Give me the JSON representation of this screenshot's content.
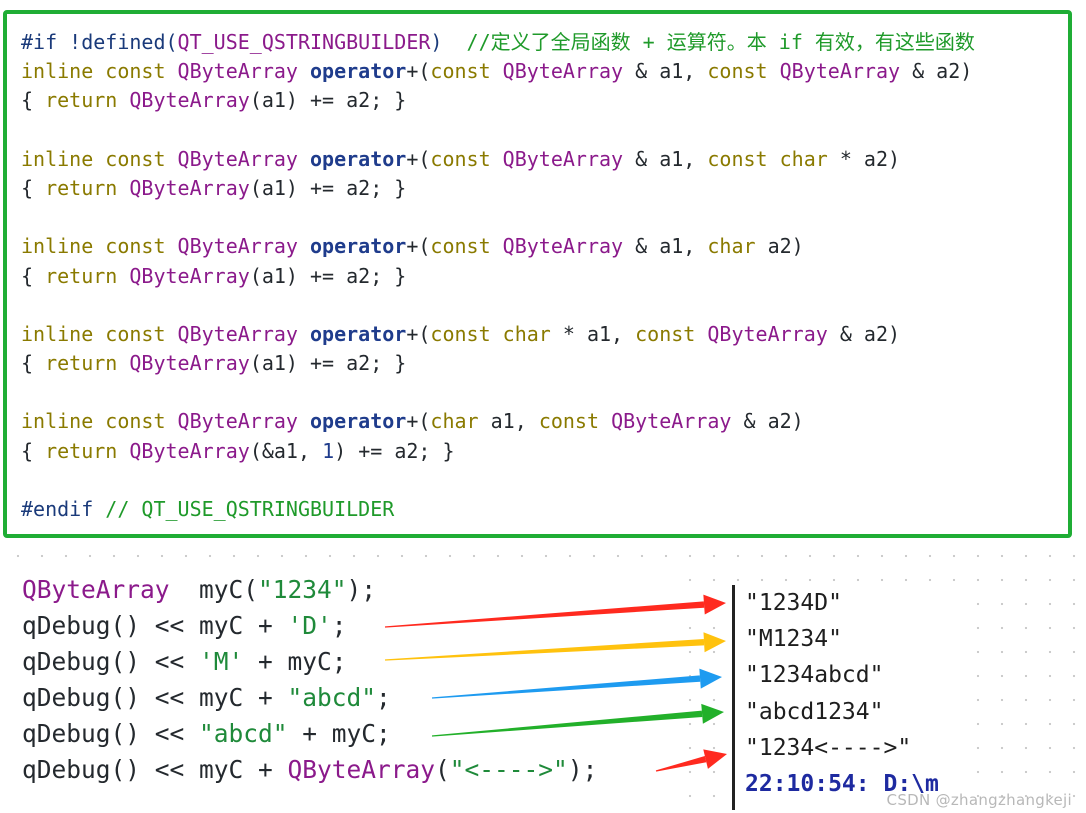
{
  "code_block": {
    "lines": [
      [
        {
          "t": "#if !defined(",
          "c": "pp"
        },
        {
          "t": "QT_USE_QSTRINGBUILDER",
          "c": "ty"
        },
        {
          "t": ")  ",
          "c": "pp"
        },
        {
          "t": "//定义了全局函数 + 运算符。本 if 有效，有这些函数",
          "c": "cm"
        }
      ],
      [
        {
          "t": "inline const ",
          "c": "kw"
        },
        {
          "t": "QByteArray ",
          "c": "ty"
        },
        {
          "t": "operator",
          "c": "op"
        },
        {
          "t": "+(",
          "c": "pl"
        },
        {
          "t": "const ",
          "c": "kw"
        },
        {
          "t": "QByteArray ",
          "c": "ty"
        },
        {
          "t": "& a1, ",
          "c": "pl"
        },
        {
          "t": "const ",
          "c": "kw"
        },
        {
          "t": "QByteArray ",
          "c": "ty"
        },
        {
          "t": "& a2)",
          "c": "pl"
        }
      ],
      [
        {
          "t": "{ ",
          "c": "pl"
        },
        {
          "t": "return ",
          "c": "kw"
        },
        {
          "t": "QByteArray",
          "c": "ty"
        },
        {
          "t": "(a1) += a2; }",
          "c": "pl"
        }
      ],
      [],
      [
        {
          "t": "inline const ",
          "c": "kw"
        },
        {
          "t": "QByteArray ",
          "c": "ty"
        },
        {
          "t": "operator",
          "c": "op"
        },
        {
          "t": "+(",
          "c": "pl"
        },
        {
          "t": "const ",
          "c": "kw"
        },
        {
          "t": "QByteArray ",
          "c": "ty"
        },
        {
          "t": "& a1, ",
          "c": "pl"
        },
        {
          "t": "const char ",
          "c": "kw"
        },
        {
          "t": "* a2)",
          "c": "pl"
        }
      ],
      [
        {
          "t": "{ ",
          "c": "pl"
        },
        {
          "t": "return ",
          "c": "kw"
        },
        {
          "t": "QByteArray",
          "c": "ty"
        },
        {
          "t": "(a1) += a2; }",
          "c": "pl"
        }
      ],
      [],
      [
        {
          "t": "inline const ",
          "c": "kw"
        },
        {
          "t": "QByteArray ",
          "c": "ty"
        },
        {
          "t": "operator",
          "c": "op"
        },
        {
          "t": "+(",
          "c": "pl"
        },
        {
          "t": "const ",
          "c": "kw"
        },
        {
          "t": "QByteArray ",
          "c": "ty"
        },
        {
          "t": "& a1, ",
          "c": "pl"
        },
        {
          "t": "char ",
          "c": "kw"
        },
        {
          "t": "a2)",
          "c": "pl"
        }
      ],
      [
        {
          "t": "{ ",
          "c": "pl"
        },
        {
          "t": "return ",
          "c": "kw"
        },
        {
          "t": "QByteArray",
          "c": "ty"
        },
        {
          "t": "(a1) += a2; }",
          "c": "pl"
        }
      ],
      [],
      [
        {
          "t": "inline const ",
          "c": "kw"
        },
        {
          "t": "QByteArray ",
          "c": "ty"
        },
        {
          "t": "operator",
          "c": "op"
        },
        {
          "t": "+(",
          "c": "pl"
        },
        {
          "t": "const char ",
          "c": "kw"
        },
        {
          "t": "* a1, ",
          "c": "pl"
        },
        {
          "t": "const ",
          "c": "kw"
        },
        {
          "t": "QByteArray ",
          "c": "ty"
        },
        {
          "t": "& a2)",
          "c": "pl"
        }
      ],
      [
        {
          "t": "{ ",
          "c": "pl"
        },
        {
          "t": "return ",
          "c": "kw"
        },
        {
          "t": "QByteArray",
          "c": "ty"
        },
        {
          "t": "(a1) += a2; }",
          "c": "pl"
        }
      ],
      [],
      [
        {
          "t": "inline const ",
          "c": "kw"
        },
        {
          "t": "QByteArray ",
          "c": "ty"
        },
        {
          "t": "operator",
          "c": "op"
        },
        {
          "t": "+(",
          "c": "pl"
        },
        {
          "t": "char ",
          "c": "kw"
        },
        {
          "t": "a1, ",
          "c": "pl"
        },
        {
          "t": "const ",
          "c": "kw"
        },
        {
          "t": "QByteArray ",
          "c": "ty"
        },
        {
          "t": "& a2)",
          "c": "pl"
        }
      ],
      [
        {
          "t": "{ ",
          "c": "pl"
        },
        {
          "t": "return ",
          "c": "kw"
        },
        {
          "t": "QByteArray",
          "c": "ty"
        },
        {
          "t": "(&a1, ",
          "c": "pl"
        },
        {
          "t": "1",
          "c": "num"
        },
        {
          "t": ") += a2; }",
          "c": "pl"
        }
      ],
      [],
      [
        {
          "t": "#endif ",
          "c": "pp"
        },
        {
          "t": "// QT_USE_QSTRINGBUILDER",
          "c": "cm"
        }
      ]
    ]
  },
  "example_code": {
    "lines": [
      [
        {
          "t": "QByteArray",
          "c": "t1"
        },
        {
          "t": "  myC(",
          "c": "pl"
        },
        {
          "t": "\"1234\"",
          "c": "str"
        },
        {
          "t": ");",
          "c": "pl"
        }
      ],
      [
        {
          "t": "qDebug() << myC + ",
          "c": "pl"
        },
        {
          "t": "'D'",
          "c": "str"
        },
        {
          "t": ";",
          "c": "pl"
        }
      ],
      [
        {
          "t": "qDebug() << ",
          "c": "pl"
        },
        {
          "t": "'M'",
          "c": "str"
        },
        {
          "t": " + myC;",
          "c": "pl"
        }
      ],
      [
        {
          "t": "qDebug() << myC + ",
          "c": "pl"
        },
        {
          "t": "\"abcd\"",
          "c": "str"
        },
        {
          "t": ";",
          "c": "pl"
        }
      ],
      [
        {
          "t": "qDebug() << ",
          "c": "pl"
        },
        {
          "t": "\"abcd\"",
          "c": "str"
        },
        {
          "t": " + myC;",
          "c": "pl"
        }
      ],
      [
        {
          "t": "qDebug() << myC + ",
          "c": "pl"
        },
        {
          "t": "QByteArray",
          "c": "t1"
        },
        {
          "t": "(",
          "c": "pl"
        },
        {
          "t": "\"<---->\"",
          "c": "str"
        },
        {
          "t": ");",
          "c": "pl"
        }
      ]
    ]
  },
  "console_output": {
    "lines": [
      "\"1234D\"",
      "\"M1234\"",
      "\"1234abcd\"",
      "\"abcd1234\"",
      "\"1234<---->\""
    ],
    "timestamp_line": "22:10:54: D:\\m"
  },
  "arrow_colors": [
    "#ff2a1f",
    "#ffc20e",
    "#1e9bf0",
    "#22b02a",
    "#ff2a1f"
  ],
  "watermark": "CSDN @zhangzhangkeji"
}
